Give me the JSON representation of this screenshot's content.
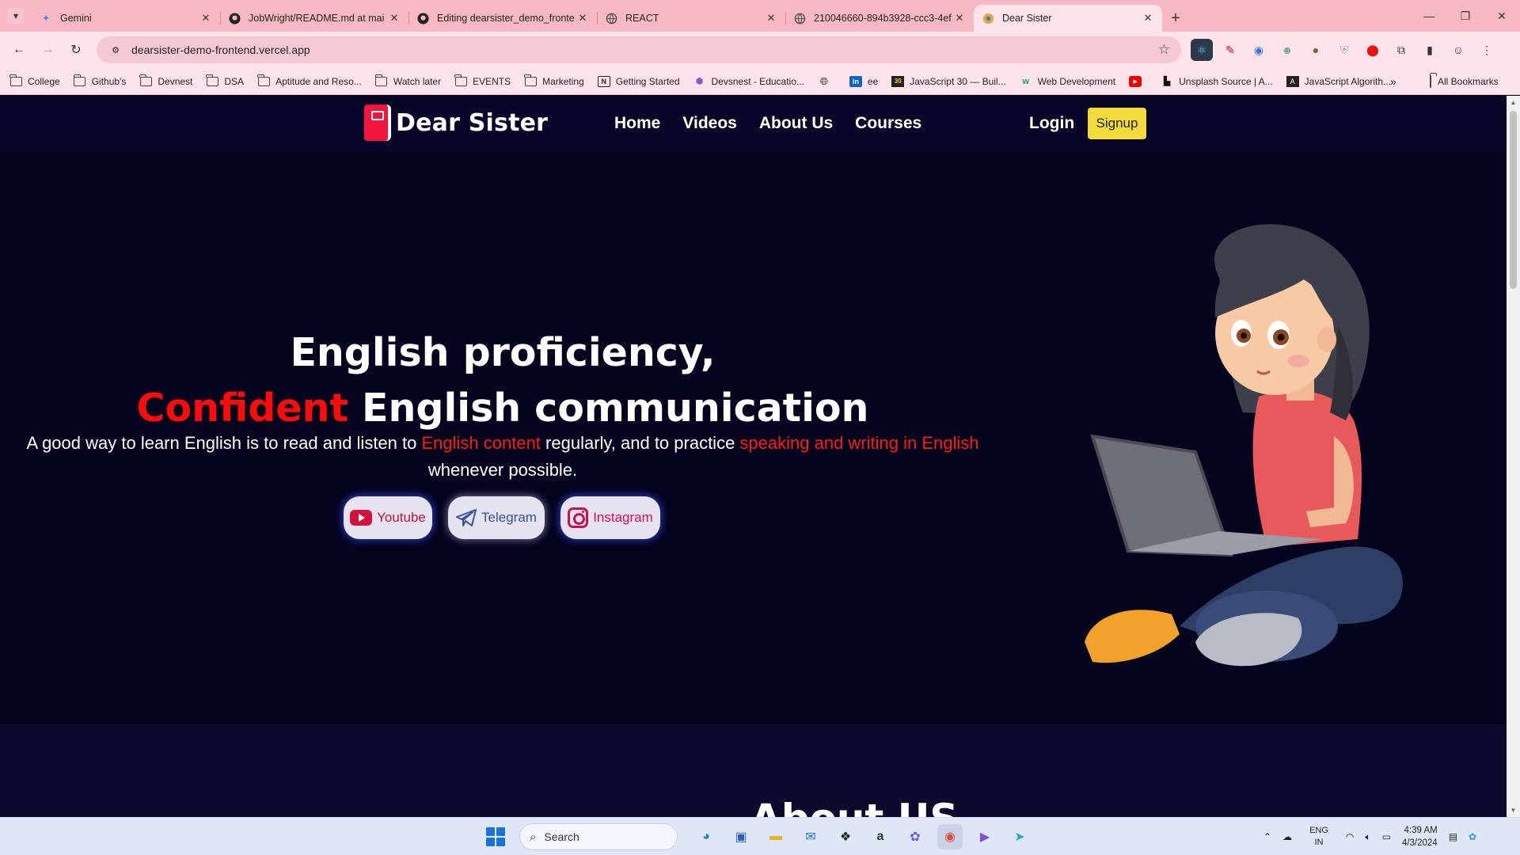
{
  "browser": {
    "tabs": [
      {
        "title": "Gemini",
        "icon": "gemini-icon"
      },
      {
        "title": "JobWright/README.md at mai",
        "icon": "github-icon"
      },
      {
        "title": "Editing dearsister_demo_fronte",
        "icon": "github-icon"
      },
      {
        "title": "REACT",
        "icon": "globe-icon"
      },
      {
        "title": "210046660-894b3928-ccc3-4ef",
        "icon": "globe-icon"
      },
      {
        "title": "Dear Sister",
        "icon": "site-icon",
        "active": true
      }
    ],
    "url": "dearsister-demo-frontend.vercel.app",
    "bookmarks": [
      {
        "label": "College",
        "icon": "folder"
      },
      {
        "label": "Github's",
        "icon": "folder"
      },
      {
        "label": "Devnest",
        "icon": "folder"
      },
      {
        "label": "DSA",
        "icon": "folder"
      },
      {
        "label": "Aptitude and Reso...",
        "icon": "folder"
      },
      {
        "label": "Watch later",
        "icon": "folder"
      },
      {
        "label": "EVENTS",
        "icon": "folder"
      },
      {
        "label": "Marketing",
        "icon": "folder"
      },
      {
        "label": "Getting Started",
        "icon": "notion"
      },
      {
        "label": "Devsnest - Educatio...",
        "icon": "hex"
      },
      {
        "label": "",
        "icon": "globe"
      },
      {
        "label": "ee",
        "icon": "linkedin"
      },
      {
        "label": "JavaScript 30 — Buil...",
        "icon": "js30"
      },
      {
        "label": "Web Development",
        "icon": "w"
      },
      {
        "label": "",
        "icon": "youtube"
      },
      {
        "label": "Unsplash Source | A...",
        "icon": "unsplash"
      },
      {
        "label": "JavaScript Algorith...",
        "icon": "algo"
      }
    ],
    "all_bookmarks": "All Bookmarks"
  },
  "site": {
    "brand": "Dear Sister",
    "nav": [
      "Home",
      "Videos",
      "About Us",
      "Courses"
    ],
    "login": "Login",
    "signup": "Signup",
    "hero": {
      "line1": "English proficiency,",
      "line2_red": "Confident",
      "line2_rest": " English communication",
      "sub_a": "A good way to learn English is to read and listen to ",
      "sub_red1": "English content",
      "sub_b": " regularly, and to practice ",
      "sub_red2": "speaking and writing in English",
      "sub_c": "whenever possible."
    },
    "social": {
      "youtube": "Youtube",
      "telegram": "Telegram",
      "instagram": "Instagram"
    },
    "about_title": "About US"
  },
  "taskbar": {
    "search_placeholder": "Search",
    "lang_top": "ENG",
    "lang_bottom": "IN",
    "time": "4:39 AM",
    "date": "4/3/2024"
  },
  "colors": {
    "accent_red": "#ff0a0a",
    "signup_yellow": "#f4db3c",
    "page_bg": "#05041f",
    "chrome_pink": "#f7b8c6"
  }
}
